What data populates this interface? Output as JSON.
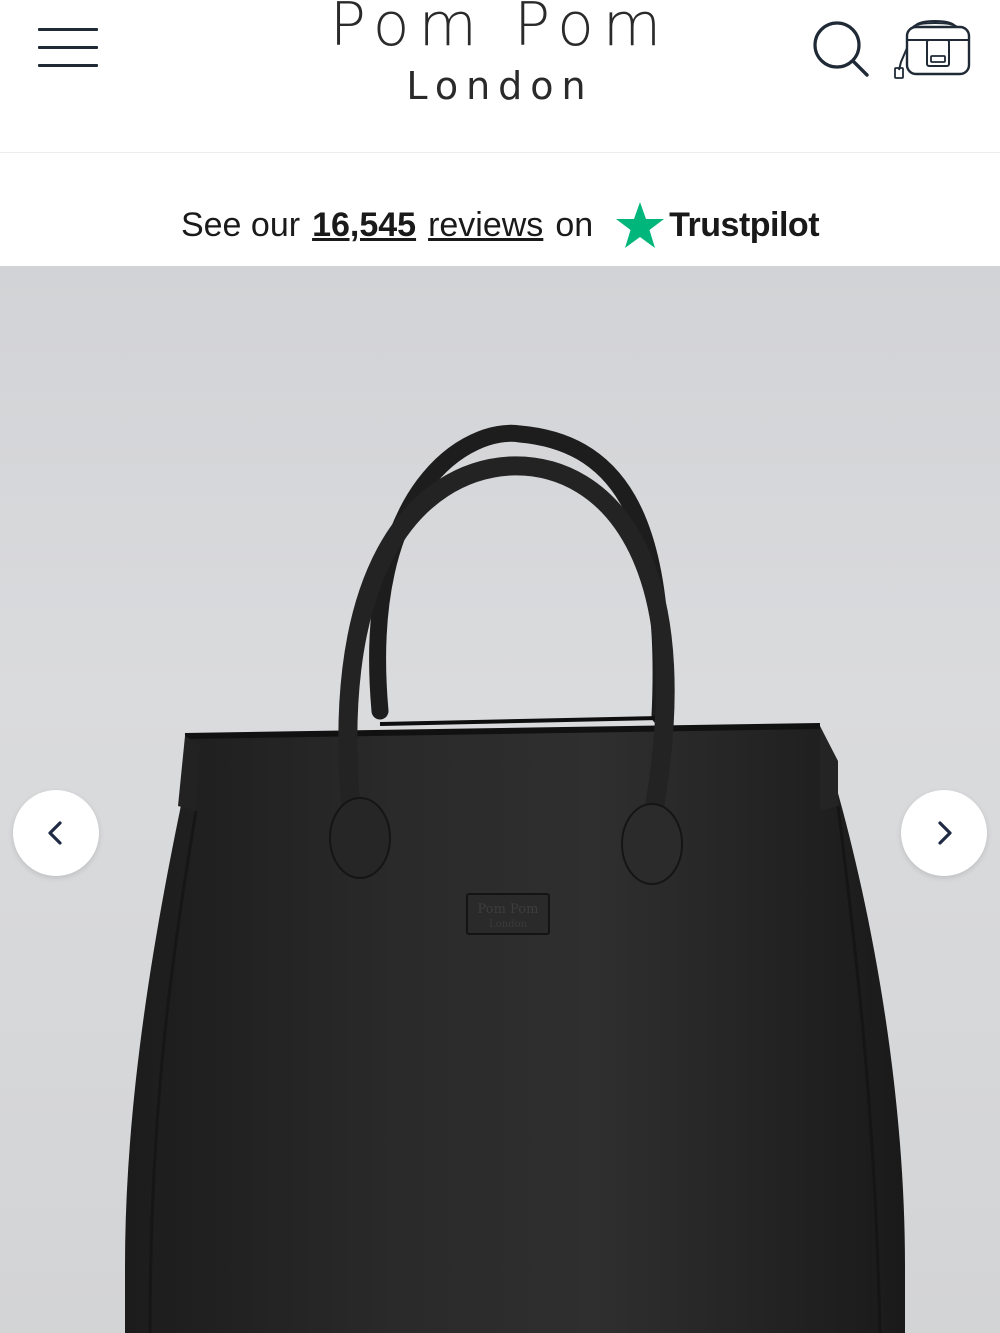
{
  "header": {
    "brand_name": "Pom Pom",
    "brand_sub": "London",
    "icons": {
      "menu": "hamburger-menu-icon",
      "search": "search-icon",
      "bag": "bag-icon"
    },
    "icon_color": "#1f2a36"
  },
  "trust_banner": {
    "prefix": "See our",
    "count": "16,545",
    "reviews_word": "reviews",
    "on_word": "on",
    "provider": "Trustpilot",
    "star_color": "#00b67a"
  },
  "gallery": {
    "product_image": "black-leather-tote-bag",
    "embossed_logo_top": "Pom Pom",
    "embossed_logo_bottom": "London",
    "prev_icon": "chevron-left-icon",
    "next_icon": "chevron-right-icon"
  }
}
